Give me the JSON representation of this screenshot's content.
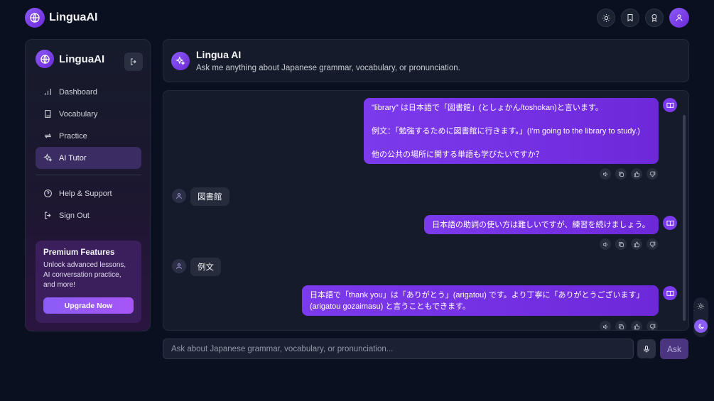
{
  "app": {
    "brand": "LinguaAI"
  },
  "topbar": {
    "icons": [
      "sun-icon",
      "bookmark-icon",
      "award-icon",
      "user-icon"
    ]
  },
  "sidebar": {
    "brand": "LinguaAI",
    "nav": [
      {
        "label": "Dashboard",
        "icon": "bar-chart-icon",
        "active": false
      },
      {
        "label": "Vocabulary",
        "icon": "book-icon",
        "active": false
      },
      {
        "label": "Practice",
        "icon": "repeat-icon",
        "active": false
      },
      {
        "label": "AI Tutor",
        "icon": "sparkles-icon",
        "active": true
      }
    ],
    "secondary": [
      {
        "label": "Help & Support",
        "icon": "help-circle-icon"
      },
      {
        "label": "Sign Out",
        "icon": "log-out-icon"
      }
    ],
    "premium": {
      "title": "Premium Features",
      "text": "Unlock advanced lessons, AI conversation practice, and more!",
      "button": "Upgrade Now"
    }
  },
  "header": {
    "title": "Lingua AI",
    "subtitle": "Ask me anything about Japanese grammar, vocabulary, or pronunciation."
  },
  "messages": [
    {
      "role": "ai",
      "lines": [
        "\"library\" は日本語で「図書館」(としょかん/toshokan)と言います。",
        "",
        "例文：「勉強するために図書館に行きます。」(I'm going to the library to study.)",
        "",
        "他の公共の場所に関する単語も学びたいですか？"
      ]
    },
    {
      "role": "user",
      "text": "図書館"
    },
    {
      "role": "ai",
      "lines": [
        "日本語の助詞の使い方は難しいですが、練習を続けましょう。"
      ]
    },
    {
      "role": "user",
      "text": "例文"
    },
    {
      "role": "ai",
      "lines": [
        "日本語で「thank you」は「ありがとう」(arigatou) です。より丁寧に「ありがとうございます」",
        "(arigatou gozaimasu) と言うこともできます。"
      ]
    }
  ],
  "message_actions": [
    "volume-icon",
    "copy-icon",
    "thumbs-up-icon",
    "thumbs-down-icon"
  ],
  "composer": {
    "placeholder": "Ask about Japanese grammar, vocabulary, or pronunciation...",
    "ask_label": "Ask"
  },
  "colors": {
    "background": "#0b1020",
    "accent": "#7c3aed",
    "panel": "#161b2b"
  }
}
